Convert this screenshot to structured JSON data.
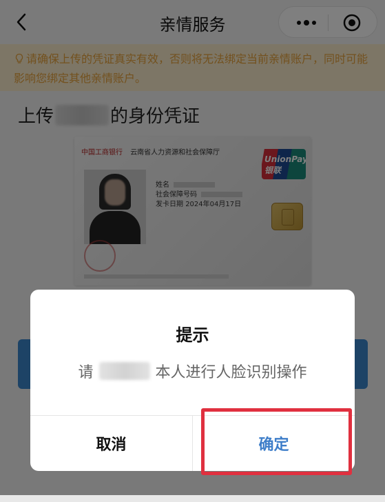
{
  "navbar": {
    "title": "亲情服务"
  },
  "notice": {
    "text": "请确保上传的凭证真实有效，否则将无法绑定当前亲情账户，同时可能影响您绑定其他亲情账户。"
  },
  "upload": {
    "prefix": "上传",
    "suffix": "的身份凭证"
  },
  "card": {
    "issuer": "中国工商银行",
    "department": "云南省人力资源和社会保障厅",
    "name_label": "姓名",
    "ss_number_label": "社会保障号码",
    "issue_date_label": "发卡日期",
    "issue_date_value": "2024年04月17日",
    "brand": "UnionPay 银联"
  },
  "dialog": {
    "title": "提示",
    "message_prefix": "请",
    "message_suffix": "本人进行人脸识别操作",
    "cancel_label": "取消",
    "confirm_label": "确定"
  },
  "colors": {
    "accent": "#3e7ec9",
    "notice_bg": "#fbeccc",
    "notice_text": "#e6a23c",
    "highlight": "#e0303f"
  }
}
